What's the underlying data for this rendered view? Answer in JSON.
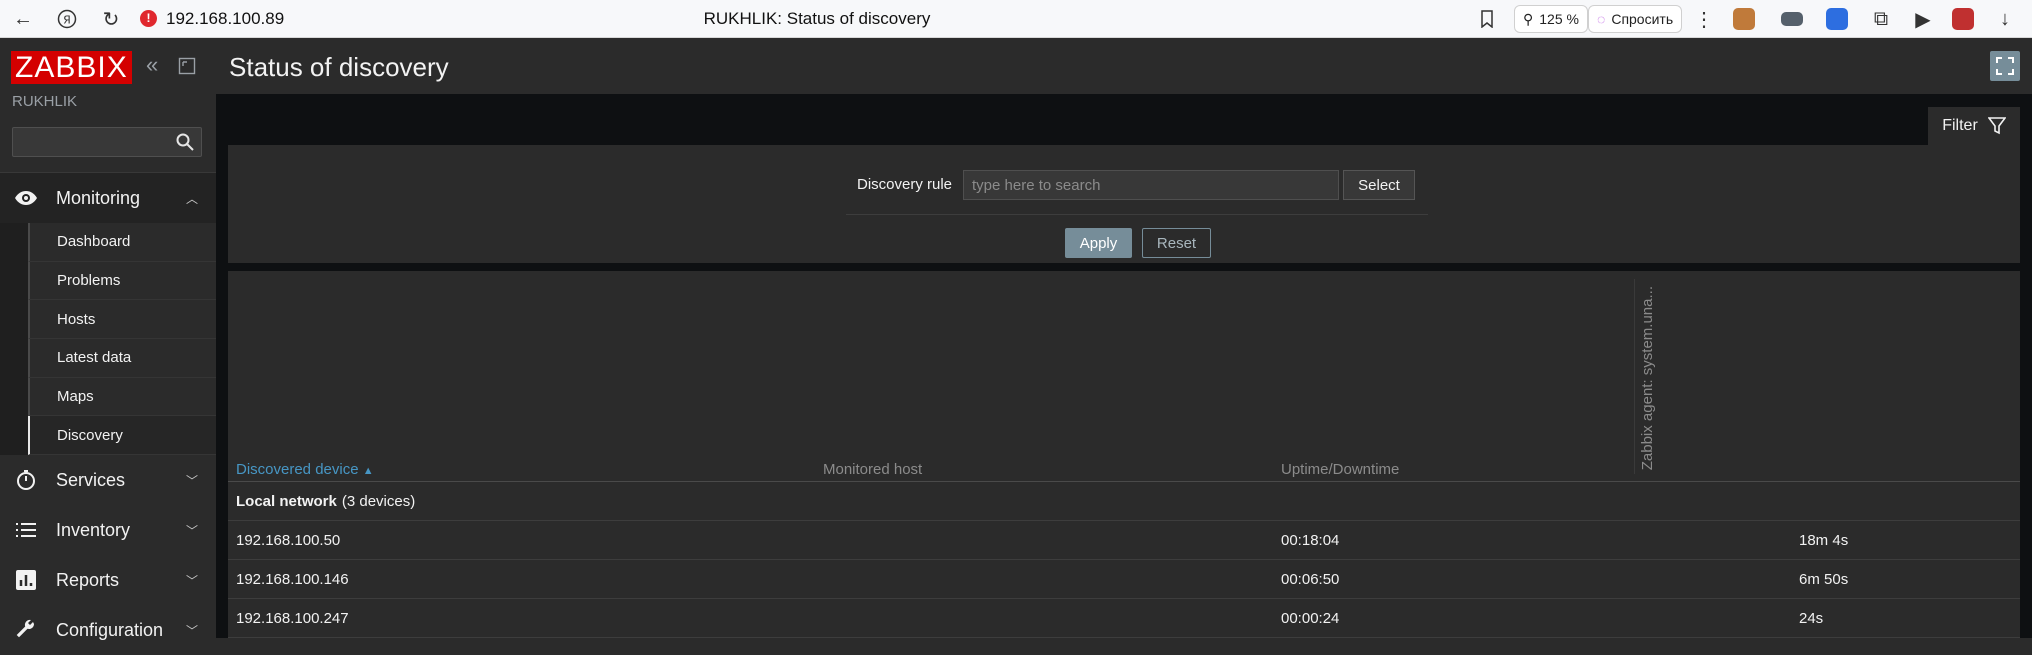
{
  "browser": {
    "url": "192.168.100.89",
    "tab_title": "RUKHLIK: Status of discovery",
    "zoom": "125 %",
    "ask_label": "Спросить"
  },
  "sidebar": {
    "logo": "ZABBIX",
    "server_name": "RUKHLIK",
    "search_placeholder": "",
    "menu": [
      {
        "label": "Monitoring",
        "icon": "eye-icon",
        "expanded": true
      },
      {
        "label": "Services",
        "icon": "stopwatch-icon"
      },
      {
        "label": "Inventory",
        "icon": "list-icon"
      },
      {
        "label": "Reports",
        "icon": "bar-chart-icon"
      },
      {
        "label": "Configuration",
        "icon": "wrench-icon"
      }
    ],
    "monitoring_items": [
      "Dashboard",
      "Problems",
      "Hosts",
      "Latest data",
      "Maps",
      "Discovery"
    ]
  },
  "header": {
    "title": "Status of discovery"
  },
  "filter": {
    "tab_label": "Filter",
    "rule_label": "Discovery rule",
    "rule_placeholder": "type here to search",
    "select_label": "Select",
    "apply_label": "Apply",
    "reset_label": "Reset"
  },
  "table": {
    "columns": [
      "Discovered device",
      "Monitored host",
      "Uptime/Downtime",
      "Zabbix agent: system.una..."
    ],
    "sort_indicator": "▲",
    "group": {
      "name": "Local network",
      "count": "(3 devices)"
    },
    "rows": [
      {
        "device": "192.168.100.50",
        "host": "",
        "uptime": "00:18:04",
        "check": "18m 4s"
      },
      {
        "device": "192.168.100.146",
        "host": "",
        "uptime": "00:06:50",
        "check": "6m 50s"
      },
      {
        "device": "192.168.100.247",
        "host": "",
        "uptime": "00:00:24",
        "check": "24s"
      }
    ]
  },
  "colors": {
    "accent": "#768d99",
    "brand_red": "#d40000",
    "link": "#4796c4",
    "background": "#2b2b2b"
  }
}
